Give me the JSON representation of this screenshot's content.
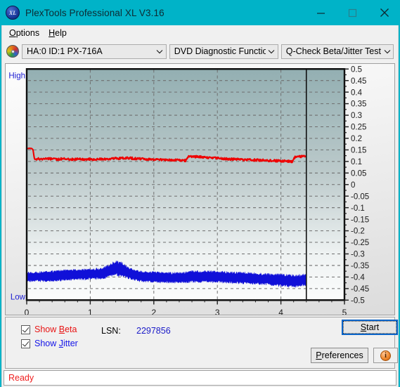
{
  "window": {
    "title": "PlexTools Professional XL V3.16",
    "app_icon": "xl-logo-icon",
    "minimize": "minimize-icon",
    "maximize": "maximize-icon",
    "close": "close-icon",
    "titlebar_color": "#00b3c8"
  },
  "menu": {
    "items": [
      {
        "label": "Options",
        "accel": "O"
      },
      {
        "label": "Help",
        "accel": "H"
      }
    ]
  },
  "toolbar": {
    "disc_icon": "optical-disc-icon",
    "drive": {
      "value": "HA:0 ID:1  PX-716A",
      "chevron": "chevron-down-icon"
    },
    "function": {
      "value": "DVD Diagnostic Functions",
      "chevron": "chevron-down-icon"
    },
    "test": {
      "value": "Q-Check Beta/Jitter Test",
      "chevron": "chevron-down-icon"
    }
  },
  "chart_data": {
    "type": "line",
    "title": "",
    "xlabel": "",
    "ylabel": "",
    "xlim": [
      0,
      5
    ],
    "ylim": [
      -0.5,
      0.5
    ],
    "grid": true,
    "axis_high_label": "High",
    "axis_low_label": "Low",
    "x_ticks": [
      "0",
      "1",
      "2",
      "3",
      "4",
      "5"
    ],
    "x_tick_values": [
      0,
      1,
      2,
      3,
      4,
      5
    ],
    "y_ticks": [
      "0.5",
      "0.45",
      "0.4",
      "0.35",
      "0.3",
      "0.25",
      "0.2",
      "0.15",
      "0.1",
      "0.05",
      "0",
      "-0.05",
      "-0.1",
      "-0.15",
      "-0.2",
      "-0.25",
      "-0.3",
      "-0.35",
      "-0.4",
      "-0.45",
      "-0.5"
    ],
    "y_tick_values": [
      0.5,
      0.45,
      0.4,
      0.35,
      0.3,
      0.25,
      0.2,
      0.15,
      0.1,
      0.05,
      0,
      -0.05,
      -0.1,
      -0.15,
      -0.2,
      -0.25,
      -0.3,
      -0.35,
      -0.4,
      -0.45,
      -0.5
    ],
    "data_end_x": 4.4,
    "cursor_x": 4.4,
    "legend": [
      "Show Beta",
      "Show Jitter"
    ],
    "series": [
      {
        "name": "Beta",
        "color": "#ee0000",
        "x": [
          0.0,
          0.04,
          0.08,
          0.1,
          0.12,
          0.16,
          0.2,
          0.26,
          0.32,
          0.4,
          0.48,
          0.56,
          0.64,
          0.72,
          0.8,
          0.88,
          0.96,
          1.04,
          1.12,
          1.2,
          1.28,
          1.36,
          1.44,
          1.52,
          1.56,
          1.6,
          1.68,
          1.76,
          1.84,
          1.92,
          2.0,
          2.1,
          2.2,
          2.3,
          2.4,
          2.5,
          2.54,
          2.58,
          2.62,
          2.7,
          2.8,
          2.9,
          3.0,
          3.1,
          3.2,
          3.3,
          3.4,
          3.5,
          3.6,
          3.7,
          3.8,
          3.9,
          4.0,
          4.1,
          4.18,
          4.22,
          4.28,
          4.34,
          4.4
        ],
        "y": [
          0.155,
          0.157,
          0.156,
          0.15,
          0.112,
          0.11,
          0.111,
          0.11,
          0.112,
          0.111,
          0.11,
          0.111,
          0.11,
          0.109,
          0.11,
          0.109,
          0.11,
          0.109,
          0.11,
          0.111,
          0.11,
          0.112,
          0.113,
          0.114,
          0.116,
          0.115,
          0.113,
          0.112,
          0.111,
          0.11,
          0.109,
          0.108,
          0.107,
          0.106,
          0.105,
          0.104,
          0.12,
          0.122,
          0.121,
          0.12,
          0.118,
          0.116,
          0.114,
          0.112,
          0.11,
          0.109,
          0.108,
          0.107,
          0.106,
          0.105,
          0.104,
          0.103,
          0.102,
          0.101,
          0.1,
          0.118,
          0.12,
          0.121,
          0.122
        ]
      },
      {
        "name": "Jitter",
        "color": "#1010d8",
        "band_center_x": [
          0.0,
          0.2,
          0.4,
          0.6,
          0.8,
          1.0,
          1.2,
          1.3,
          1.4,
          1.5,
          1.6,
          1.7,
          1.8,
          2.0,
          2.2,
          2.4,
          2.6,
          2.8,
          3.0,
          3.2,
          3.4,
          3.6,
          3.8,
          4.0,
          4.2,
          4.4
        ],
        "band_center_y": [
          -0.4,
          -0.398,
          -0.396,
          -0.392,
          -0.39,
          -0.388,
          -0.384,
          -0.372,
          -0.362,
          -0.368,
          -0.382,
          -0.392,
          -0.398,
          -0.4,
          -0.402,
          -0.404,
          -0.398,
          -0.398,
          -0.4,
          -0.402,
          -0.404,
          -0.406,
          -0.41,
          -0.414,
          -0.418,
          -0.412
        ],
        "band_halfwidth": [
          0.022,
          0.022,
          0.024,
          0.024,
          0.024,
          0.024,
          0.026,
          0.03,
          0.034,
          0.032,
          0.026,
          0.024,
          0.024,
          0.024,
          0.024,
          0.024,
          0.026,
          0.026,
          0.026,
          0.026,
          0.026,
          0.026,
          0.026,
          0.028,
          0.028,
          0.026
        ]
      }
    ]
  },
  "controls": {
    "show_beta": {
      "label": "Show Beta",
      "accel": "B",
      "checked": true,
      "color": "#e81313"
    },
    "show_jitter": {
      "label": "Show Jitter",
      "accel": "J",
      "checked": true,
      "color": "#1414e8"
    },
    "lsn_label": "LSN:",
    "lsn_value": "2297856",
    "start_button": {
      "label": "Start",
      "accel": "S"
    },
    "preferences_button": {
      "label": "Preferences",
      "accel": "P"
    },
    "info_button": {
      "glyph": "i",
      "name": "info-icon"
    }
  },
  "status": {
    "text": "Ready",
    "color": "#f02020"
  }
}
